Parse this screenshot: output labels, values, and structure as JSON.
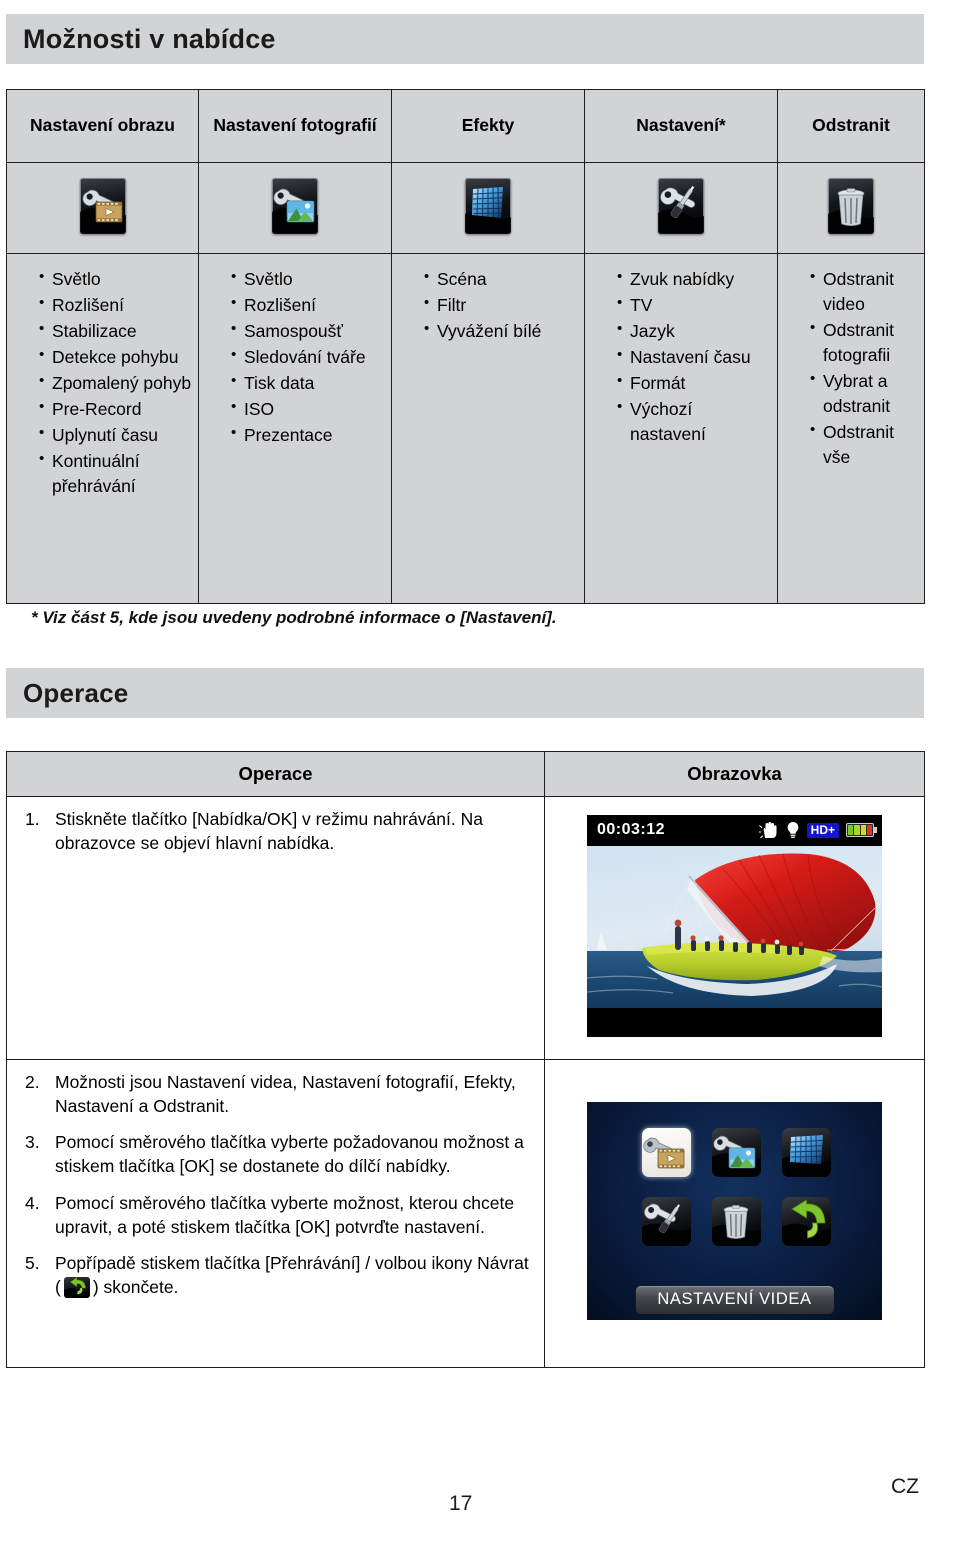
{
  "sections": {
    "menu_options_title": "Možnosti v nabídce",
    "operace_title": "Operace"
  },
  "options_table": {
    "columns": [
      {
        "header": "Nastavení obrazu",
        "icon": "video-settings-icon",
        "items": [
          "Světlo",
          "Rozlišení",
          "Stabilizace",
          "Detekce pohybu",
          "Zpomalený pohyb",
          "Pre-Record",
          "Uplynutí času",
          "Kontinuální přehrávání"
        ]
      },
      {
        "header": "Nastavení fotografií",
        "icon": "photo-settings-icon",
        "items": [
          "Světlo",
          "Rozlišení",
          "Samospoušť",
          "Sledování tváře",
          "Tisk data",
          "ISO",
          "Prezentace"
        ]
      },
      {
        "header": "Efekty",
        "icon": "effects-icon",
        "items": [
          "Scéna",
          "Filtr",
          "Vyvážení bílé"
        ]
      },
      {
        "header": "Nastavení*",
        "icon": "settings-icon",
        "items": [
          "Zvuk nabídky",
          "TV",
          "Jazyk",
          "Nastavení času",
          "Formát",
          "Výchozí nastavení"
        ]
      },
      {
        "header": "Odstranit",
        "icon": "trash-icon",
        "items": [
          "Odstranit video",
          "Odstranit fotografii",
          "Vybrat a odstranit",
          "Odstranit vše"
        ]
      }
    ]
  },
  "footnote": "* Viz část 5, kde jsou uvedeny podrobné informace o [Nastavení].",
  "operations_table": {
    "headers": {
      "operace": "Operace",
      "obrazovka": "Obrazovka"
    },
    "steps": [
      {
        "num": "1.",
        "text": "Stiskněte tlačítko [Nabídka/OK] v režimu nahrávání. Na obrazovce se objeví hlavní nabídka."
      },
      {
        "num": "2.",
        "text": "Možnosti jsou Nastavení videa, Nastavení fotografií, Efekty, Nastavení a Odstranit."
      },
      {
        "num": "3.",
        "text": "Pomocí směrového tlačítka vyberte požadovanou možnost a stiskem tlačítka [OK] se dostanete do dílčí nabídky."
      },
      {
        "num": "4.",
        "text": "Pomocí směrového tlačítka vyberte možnost, kterou chcete upravit, a poté stiskem tlačítka [OK] potvrďte nastavení."
      }
    ],
    "step5": {
      "num": "5.",
      "text_before": "Popřípadě stiskem tlačítka [Přehrávání] / volbou ikony Návrat (",
      "icon": "return-arrow-icon",
      "text_after": ") skončete."
    }
  },
  "lcd_preview": {
    "timecode": "00:03:12",
    "icons": [
      "hand-stabilization-icon",
      "lightbulb-icon"
    ],
    "quality_badge": "HD+",
    "battery": "battery-icon",
    "scene": "sailing-yacht-red-spinnaker"
  },
  "menu_screen": {
    "icons": [
      "video-settings-icon",
      "photo-settings-icon",
      "effects-icon",
      "settings-icon",
      "trash-icon",
      "return-arrow-icon"
    ],
    "selected_index": 0,
    "label": "NASTAVENÍ VIDEA"
  },
  "footer": {
    "page_number": "17",
    "language_code": "CZ"
  },
  "colors": {
    "banner_gray": "#d2d3d5",
    "table_cell_gray": "#d2d3d5",
    "border": "#1d1d1d",
    "menu_bg_blue": "#0b2045",
    "hd_badge_blue": "#1515c8"
  }
}
